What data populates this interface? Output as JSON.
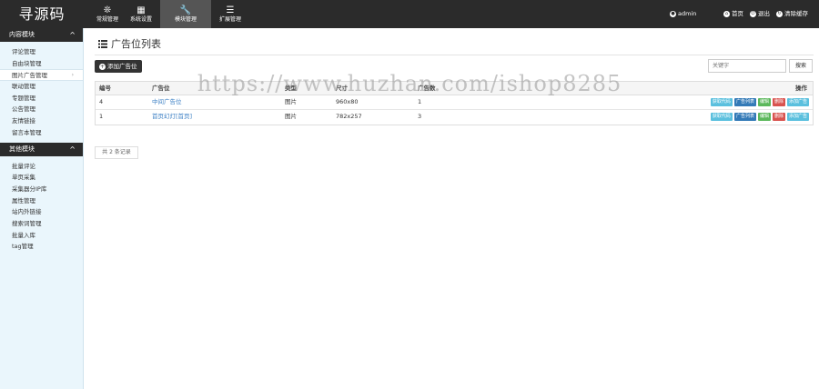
{
  "brand": "寻源码",
  "nav": [
    {
      "icon": "❊",
      "label": "常规管理"
    },
    {
      "icon": "▦",
      "label": "系统设置"
    },
    {
      "icon": "🔧",
      "label": "模块管理"
    },
    {
      "icon": "☰",
      "label": "扩展管理"
    }
  ],
  "top_right": {
    "user": "admin",
    "home": "首页",
    "logout": "退出",
    "clear_cache": "清除缓存"
  },
  "sidebar": {
    "section1": {
      "title": "内容模块",
      "items": [
        "评论管理",
        "自由块管理",
        "图片广告管理",
        "联动管理",
        "专题管理",
        "公告管理",
        "友情链接",
        "留言本管理"
      ]
    },
    "section2": {
      "title": "其他模块",
      "items": [
        "批量评论",
        "单页采集",
        "采集器分IP库",
        "属性管理",
        "站内外链接",
        "搜索词管理",
        "批量入库",
        "tag管理"
      ]
    }
  },
  "main": {
    "title": "广告位列表",
    "add_button": "添加广告位",
    "search_placeholder": "关键字",
    "search_button": "搜索",
    "columns": [
      "编号",
      "广告位",
      "类型",
      "尺寸",
      "广告数",
      "操作"
    ],
    "rows": [
      {
        "id": "4",
        "name": "中间广告位",
        "type": "图片",
        "size": "960x80",
        "count": "1"
      },
      {
        "id": "1",
        "name": "首页幻灯[首页]",
        "type": "图片",
        "size": "782x257",
        "count": "3"
      }
    ],
    "row_actions": [
      {
        "label": "获取代码",
        "color": "#5bc0de"
      },
      {
        "label": "广告列表",
        "color": "#337ab7"
      },
      {
        "label": "编辑",
        "color": "#5cb85c"
      },
      {
        "label": "删除",
        "color": "#d9534f"
      },
      {
        "label": "添加广告",
        "color": "#5bc0de"
      }
    ],
    "pager": "共 2 条记录"
  },
  "watermark": "https://www.huzhan.com/ishop8285"
}
